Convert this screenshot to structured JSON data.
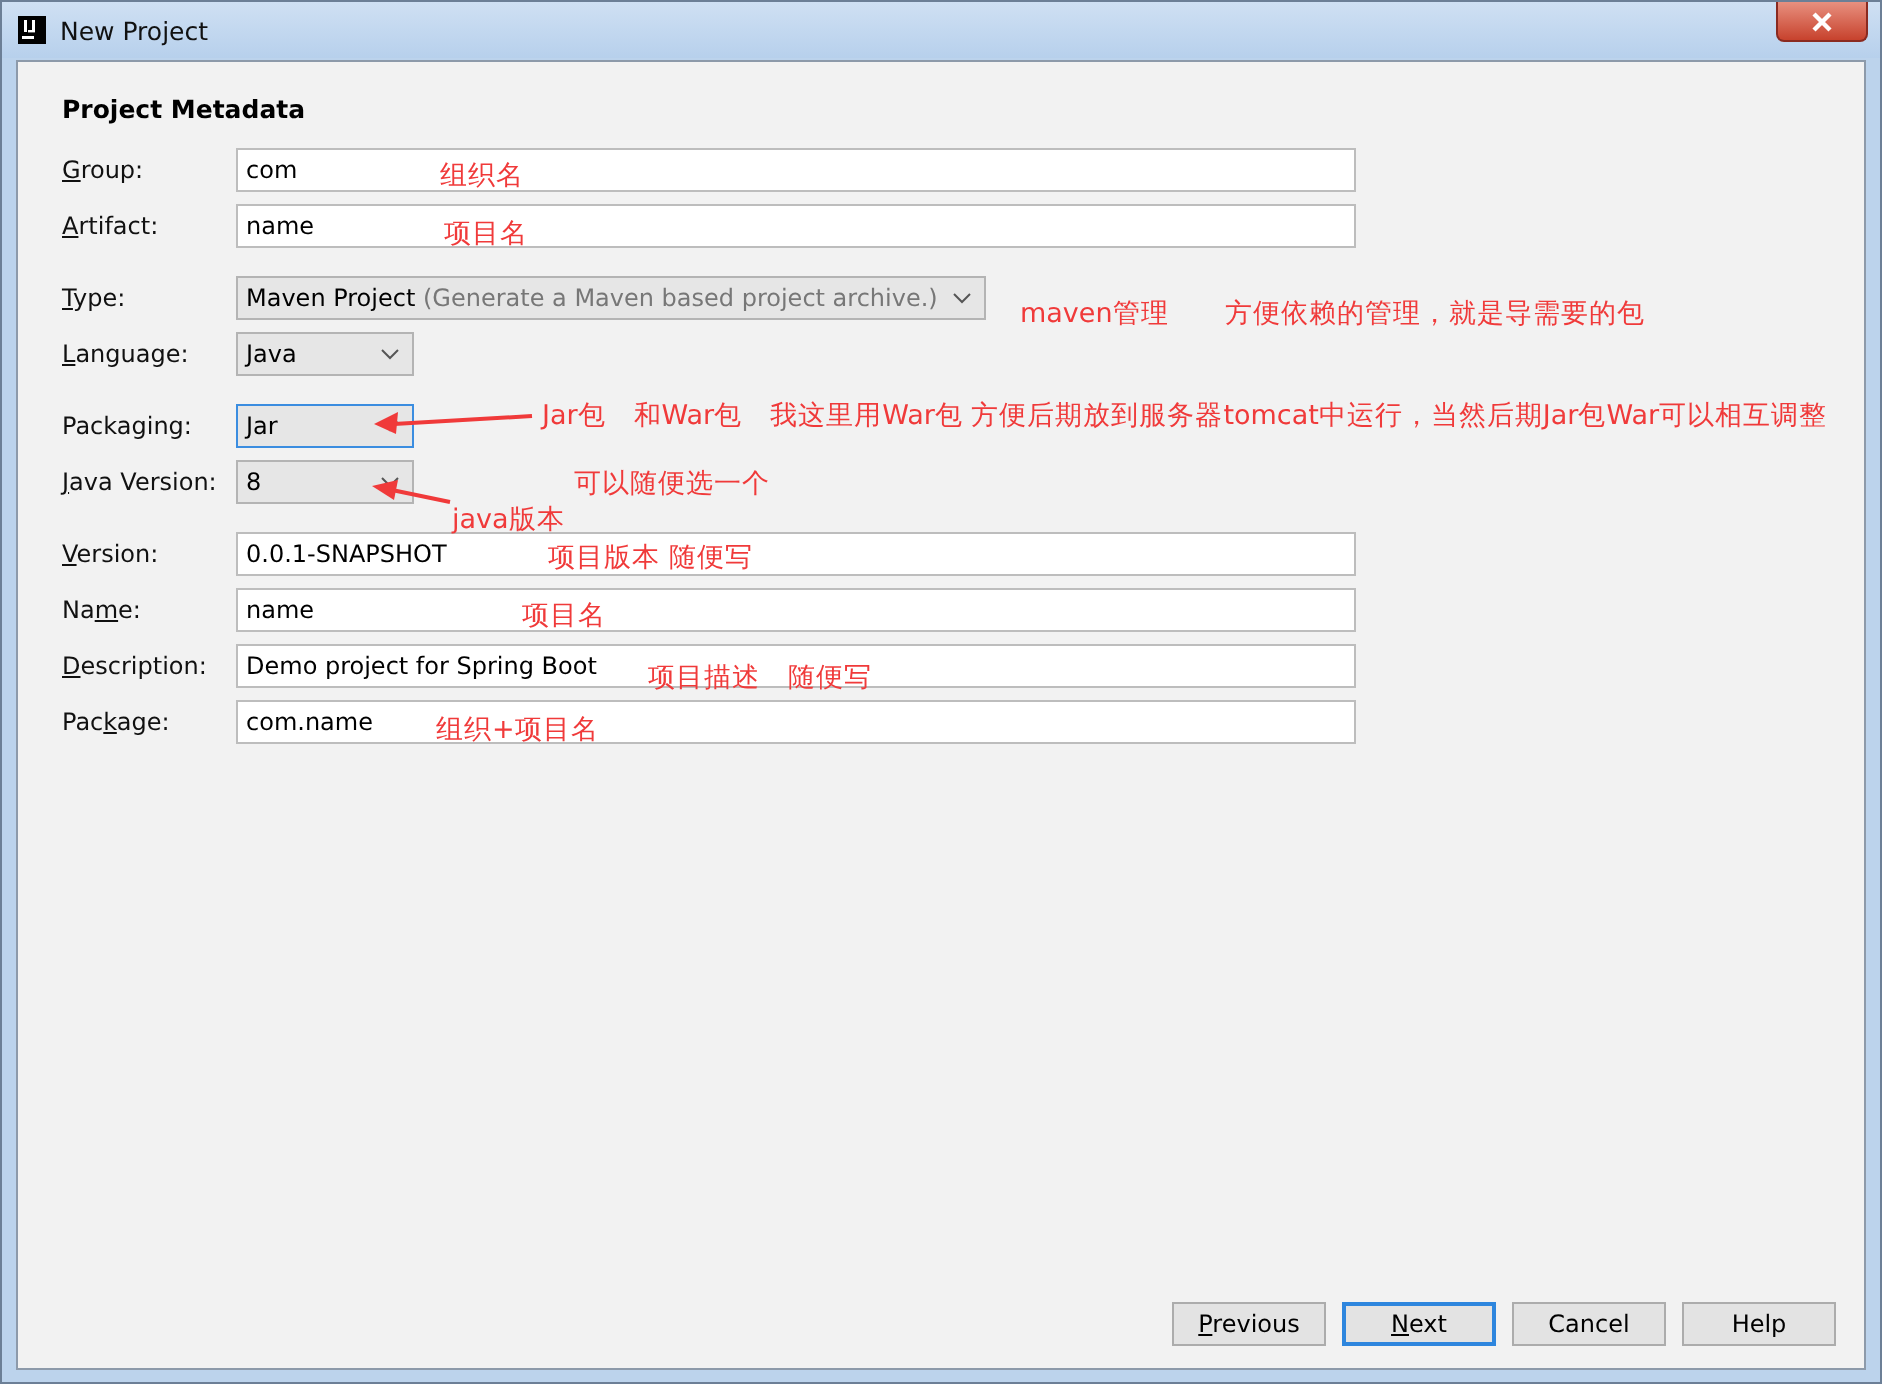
{
  "window": {
    "title": "New Project"
  },
  "section_title": "Project Metadata",
  "fields": [
    {
      "kind": "text",
      "label": {
        "key": "G",
        "after": "roup:"
      },
      "value": "com"
    },
    {
      "kind": "text",
      "label": {
        "key": "A",
        "after": "rtifact:"
      },
      "value": "name"
    },
    {
      "kind": "wide-combo",
      "label": {
        "key": "T",
        "after": "ype:"
      },
      "value": "Maven Project",
      "hint": "(Generate a Maven based project archive.)"
    },
    {
      "kind": "combo",
      "label": {
        "key": "L",
        "after": "anguage:"
      },
      "value": "Java",
      "focused": false
    },
    {
      "kind": "combo",
      "label": {
        "before": "Packaging:"
      },
      "value": "Jar",
      "focused": true
    },
    {
      "kind": "combo",
      "label": {
        "key": "J",
        "after": "ava Version:"
      },
      "value": "8",
      "focused": false
    },
    {
      "kind": "text",
      "label": {
        "key": "V",
        "after": "ersion:"
      },
      "value": "0.0.1-SNAPSHOT"
    },
    {
      "kind": "text",
      "label": {
        "before": "Na",
        "key": "m",
        "after": "e:"
      },
      "value": "name"
    },
    {
      "kind": "text",
      "label": {
        "key": "D",
        "after": "escription:"
      },
      "value": "Demo project for Spring Boot"
    },
    {
      "kind": "text",
      "label": {
        "before": "Pac",
        "key": "k",
        "after": "age:"
      },
      "value": "com.name"
    }
  ],
  "annotations": [
    "组织名",
    "项目名",
    "maven管理　　方便依赖的管理，就是导需要的包",
    "Jar包　和War包　我这里用War包 方便后期放到服务器tomcat中运行，当然后期Jar包War可以相互调整",
    "可以随便选一个",
    "java版本",
    "项目版本 随便写",
    "项目名",
    "项目描述　随便写",
    "组织+项目名"
  ],
  "buttons": [
    {
      "label": {
        "key": "P",
        "after": "revious"
      },
      "default": false
    },
    {
      "label": {
        "key": "N",
        "after": "ext"
      },
      "default": true
    },
    {
      "label": {
        "before": "Cancel"
      },
      "default": false
    },
    {
      "label": {
        "before": "Help"
      },
      "default": false
    }
  ]
}
